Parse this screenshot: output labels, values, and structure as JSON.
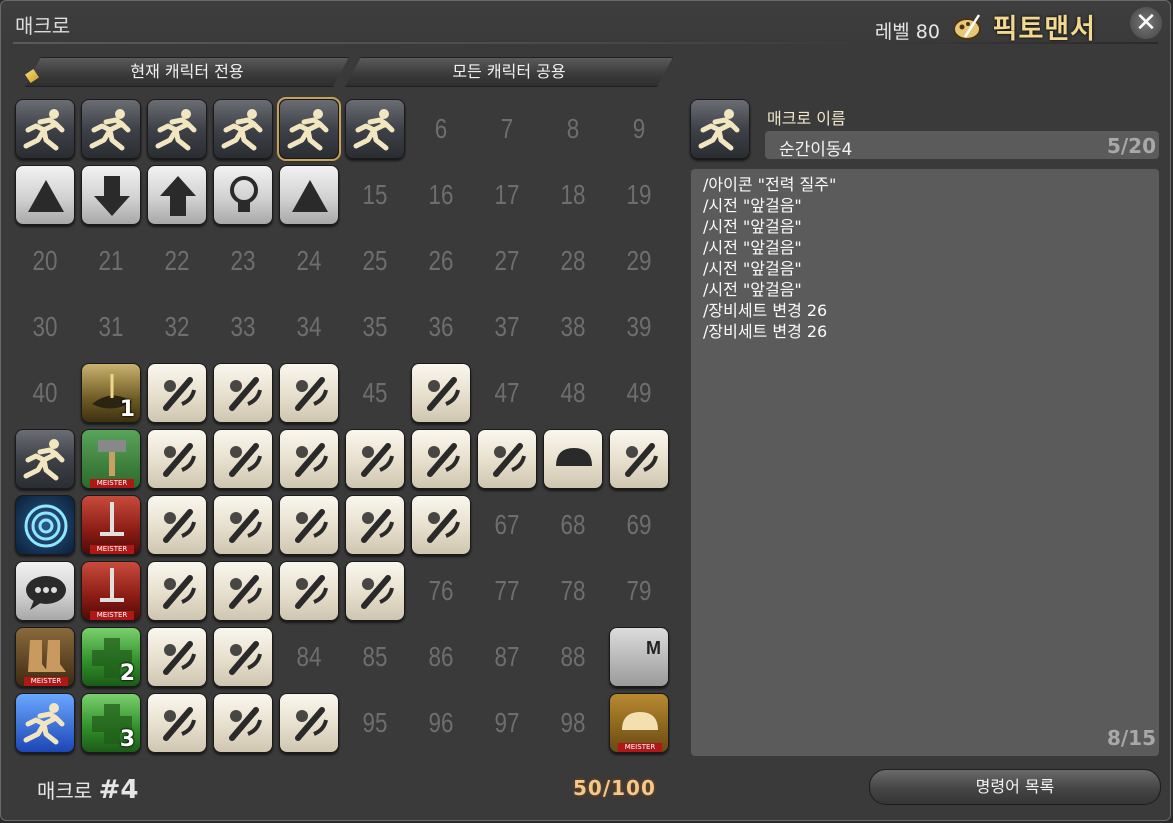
{
  "window": {
    "title": "매크로",
    "level_label": "레벨 80",
    "job_name": "픽토맨서",
    "job_icon": "pictomancer-palette-icon",
    "close_icon": "close-icon"
  },
  "tabs": [
    {
      "label": "현재 캐릭터 전용",
      "active": true
    },
    {
      "label": "모든 캐릭터 공용",
      "active": false
    }
  ],
  "macro_grid": {
    "selected_index": 4,
    "cells": [
      {
        "n": "0",
        "icon": "run-icon",
        "t": "run"
      },
      {
        "n": "1",
        "icon": "run-icon",
        "t": "run"
      },
      {
        "n": "2",
        "icon": "run-icon",
        "t": "run"
      },
      {
        "n": "3",
        "icon": "run-icon",
        "t": "run"
      },
      {
        "n": "4",
        "icon": "run-icon",
        "t": "run"
      },
      {
        "n": "5",
        "icon": "run-icon",
        "t": "run"
      },
      {
        "n": "6"
      },
      {
        "n": "7"
      },
      {
        "n": "8"
      },
      {
        "n": "9"
      },
      {
        "n": "10",
        "icon": "up-triangle-icon",
        "t": "gray"
      },
      {
        "n": "11",
        "icon": "arrow-down-icon",
        "t": "gray"
      },
      {
        "n": "12",
        "icon": "arrow-up-icon",
        "t": "gray"
      },
      {
        "n": "13",
        "icon": "lightbulb-icon",
        "t": "gray"
      },
      {
        "n": "14",
        "icon": "up-triangle-icon",
        "t": "gray"
      },
      {
        "n": "15"
      },
      {
        "n": "16"
      },
      {
        "n": "17"
      },
      {
        "n": "18"
      },
      {
        "n": "19"
      },
      {
        "n": "20"
      },
      {
        "n": "21"
      },
      {
        "n": "22"
      },
      {
        "n": "23"
      },
      {
        "n": "24"
      },
      {
        "n": "25"
      },
      {
        "n": "26"
      },
      {
        "n": "27"
      },
      {
        "n": "28"
      },
      {
        "n": "29"
      },
      {
        "n": "30"
      },
      {
        "n": "31"
      },
      {
        "n": "32"
      },
      {
        "n": "33"
      },
      {
        "n": "34"
      },
      {
        "n": "35"
      },
      {
        "n": "36"
      },
      {
        "n": "37"
      },
      {
        "n": "38"
      },
      {
        "n": "39"
      },
      {
        "n": "40"
      },
      {
        "n": "41",
        "icon": "fisher-gold-icon",
        "t": "gold",
        "badge": "1"
      },
      {
        "n": "42",
        "icon": "wheat-icon",
        "t": "cream"
      },
      {
        "n": "43",
        "icon": "pickaxe-icon",
        "t": "cream"
      },
      {
        "n": "44",
        "icon": "fish-icon",
        "t": "cream"
      },
      {
        "n": "45"
      },
      {
        "n": "46",
        "icon": "saw-blade-icon",
        "t": "cream"
      },
      {
        "n": "47"
      },
      {
        "n": "48"
      },
      {
        "n": "49"
      },
      {
        "n": "50",
        "icon": "run-icon",
        "t": "run"
      },
      {
        "n": "51",
        "icon": "hammer-meister-icon",
        "t": "greenm",
        "meister": true
      },
      {
        "n": "52",
        "icon": "helmet-icon",
        "t": "cream"
      },
      {
        "n": "53",
        "icon": "anvil-icon",
        "t": "cream"
      },
      {
        "n": "54",
        "icon": "tiara-icon",
        "t": "cream"
      },
      {
        "n": "55",
        "icon": "potion-icon",
        "t": "cream"
      },
      {
        "n": "56",
        "icon": "needle-icon",
        "t": "cream"
      },
      {
        "n": "57",
        "icon": "saw-icon",
        "t": "cream"
      },
      {
        "n": "58",
        "icon": "bread-icon",
        "t": "cream"
      },
      {
        "n": "59",
        "icon": "net-icon",
        "t": "cream"
      },
      {
        "n": "60",
        "icon": "target-ring-icon",
        "t": "blue"
      },
      {
        "n": "61",
        "icon": "sword-meister-icon",
        "t": "red",
        "meister": true
      },
      {
        "n": "62",
        "icon": "paladin-icon",
        "t": "cream"
      },
      {
        "n": "63",
        "icon": "warrior-icon",
        "t": "cream"
      },
      {
        "n": "64",
        "icon": "fist-icon",
        "t": "cream"
      },
      {
        "n": "65",
        "icon": "daggers-icon",
        "t": "cream"
      },
      {
        "n": "66",
        "icon": "swirl-icon",
        "t": "cream"
      },
      {
        "n": "67"
      },
      {
        "n": "68"
      },
      {
        "n": "69"
      },
      {
        "n": "70",
        "icon": "chat-bubble-icon",
        "t": "gray"
      },
      {
        "n": "71",
        "icon": "sword-meister-icon",
        "t": "red",
        "meister": true
      },
      {
        "n": "72",
        "icon": "gunblade-icon",
        "t": "cream"
      },
      {
        "n": "73",
        "icon": "shield-icon",
        "t": "cream"
      },
      {
        "n": "74",
        "icon": "mask-icon",
        "t": "cream"
      },
      {
        "n": "75",
        "icon": "heart-crest-icon",
        "t": "cream"
      },
      {
        "n": "76"
      },
      {
        "n": "77"
      },
      {
        "n": "78"
      },
      {
        "n": "79"
      },
      {
        "n": "80",
        "icon": "boots-meister-icon",
        "t": "boots",
        "meister": true
      },
      {
        "n": "81",
        "icon": "green-cross-icon",
        "t": "green",
        "badge": "2"
      },
      {
        "n": "82",
        "icon": "crossed-swords-icon",
        "t": "cream"
      },
      {
        "n": "83",
        "icon": "slash-circle-icon",
        "t": "cream"
      },
      {
        "n": "84"
      },
      {
        "n": "85"
      },
      {
        "n": "86"
      },
      {
        "n": "87"
      },
      {
        "n": "88"
      },
      {
        "n": "89",
        "icon": "m-letter-icon",
        "t": "m"
      },
      {
        "n": "90",
        "icon": "blue-sprint-icon",
        "t": "bluech"
      },
      {
        "n": "91",
        "icon": "green-cross-icon",
        "t": "green",
        "badge": "3"
      },
      {
        "n": "92",
        "icon": "staff-icon",
        "t": "cream"
      },
      {
        "n": "93",
        "icon": "loops-icon",
        "t": "cream"
      },
      {
        "n": "94",
        "icon": "palette-icon",
        "t": "cream"
      },
      {
        "n": "95"
      },
      {
        "n": "96"
      },
      {
        "n": "97"
      },
      {
        "n": "98"
      },
      {
        "n": "99",
        "icon": "bread-meister-icon",
        "t": "bread",
        "meister": true
      }
    ]
  },
  "footer": {
    "macro_label": "매크로",
    "macro_number": "#4",
    "usage_count": "50/100"
  },
  "editor": {
    "name_label": "매크로 이름",
    "name_value": "순간이동4",
    "name_count": "5/20",
    "lines": [
      "/아이콘 \"전력 질주\"",
      "/시전 \"앞걸음\"",
      "/시전 \"앞걸음\"",
      "/시전 \"앞걸음\"",
      "/시전 \"앞걸음\"",
      "/시전 \"앞걸음\"",
      "/장비세트 변경 26",
      "/장비세트 변경 26"
    ],
    "line_count": "8/15",
    "command_list_button": "명령어 목록"
  },
  "meister_text": "MEISTER"
}
